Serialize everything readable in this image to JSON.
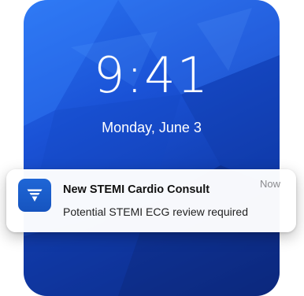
{
  "lock_screen": {
    "time": "9:41",
    "date": "Monday, June 3"
  },
  "notification": {
    "app_icon": "stemi-app-logo-icon",
    "title": "New STEMI Cardio Consult",
    "body": "Potential STEMI ECG review required",
    "time": "Now"
  },
  "colors": {
    "wallpaper_light": "#2a73f0",
    "wallpaper_dark": "#0d2c86",
    "app_icon": "#1a5bcc"
  }
}
